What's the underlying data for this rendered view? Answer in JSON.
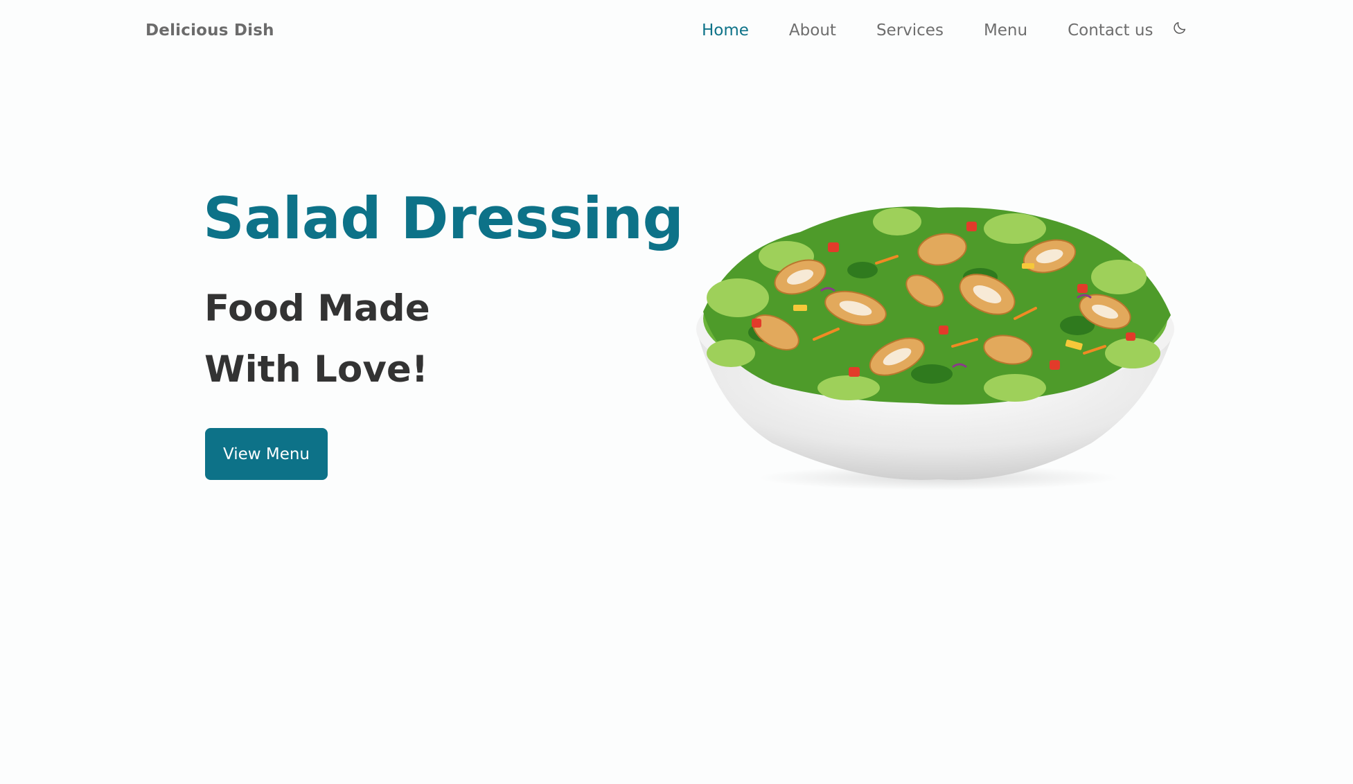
{
  "header": {
    "logo_text": "Delicious Dish",
    "nav": {
      "home": "Home",
      "about": "About",
      "services": "Services",
      "menu": "Menu",
      "contact": "Contact us"
    },
    "theme_icon": "moon-icon"
  },
  "hero": {
    "title": "Salad Dressing",
    "subtitle_line1": "Food Made",
    "subtitle_line2": "With Love!",
    "cta_label": "View Menu",
    "image": "salad-bowl-image"
  },
  "colors": {
    "accent": "#0d7288",
    "text_dark": "#333333",
    "text_muted": "#6e6e6e",
    "background": "#fcfdfd"
  }
}
